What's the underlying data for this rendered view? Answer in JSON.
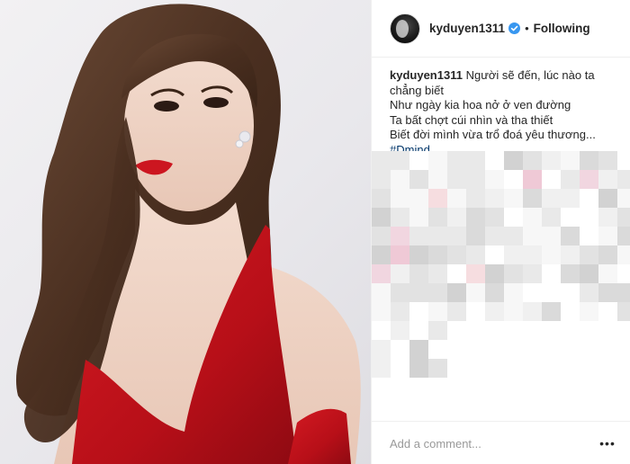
{
  "post": {
    "username": "kyduyen1311",
    "separator": "•",
    "follow_status": "Following",
    "caption": {
      "username": "kyduyen1311",
      "lines": [
        "Người sẽ đến, lúc nào ta chẳng biết",
        "Như ngày kia hoa nở ở ven đường",
        "Ta bất chợt cúi nhìn và tha thiết",
        "Biết đời mình vừa trổ đoá yêu thương..."
      ],
      "hashtag": "#Dmind"
    },
    "comment": {
      "placeholder": "Add a comment...",
      "value": ""
    }
  },
  "icons": {
    "verified": "verified-badge-icon",
    "more": "more-options-icon"
  },
  "colors": {
    "verified_blue": "#3897f0",
    "hashtag": "#003569",
    "text": "#262626",
    "muted": "#999999",
    "dress_red": "#c5121c"
  }
}
